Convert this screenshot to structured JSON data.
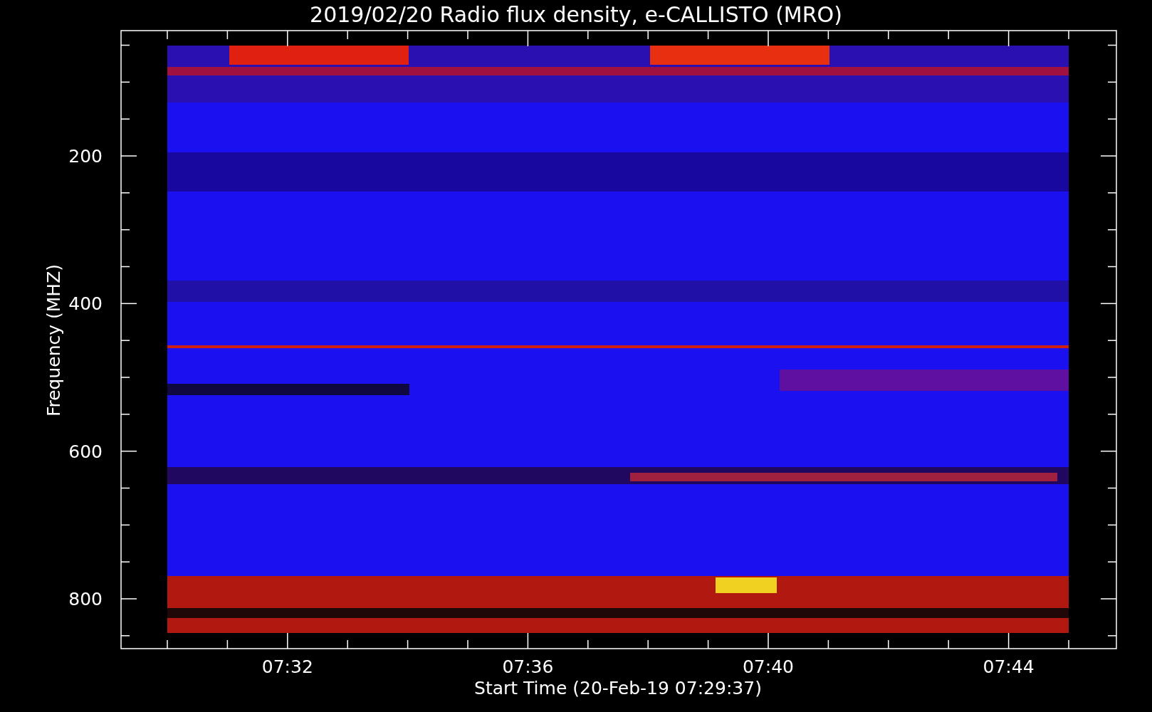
{
  "title": "2019/02/20  Radio flux density, e-CALLISTO (MRO)",
  "y_axis": {
    "label": "Frequency (MHZ)",
    "ticks": [
      "200",
      "400",
      "600",
      "800"
    ]
  },
  "x_axis": {
    "label": "Start Time (20-Feb-19 07:29:37)",
    "ticks": [
      "07:32",
      "07:36",
      "07:40",
      "07:44"
    ]
  }
}
